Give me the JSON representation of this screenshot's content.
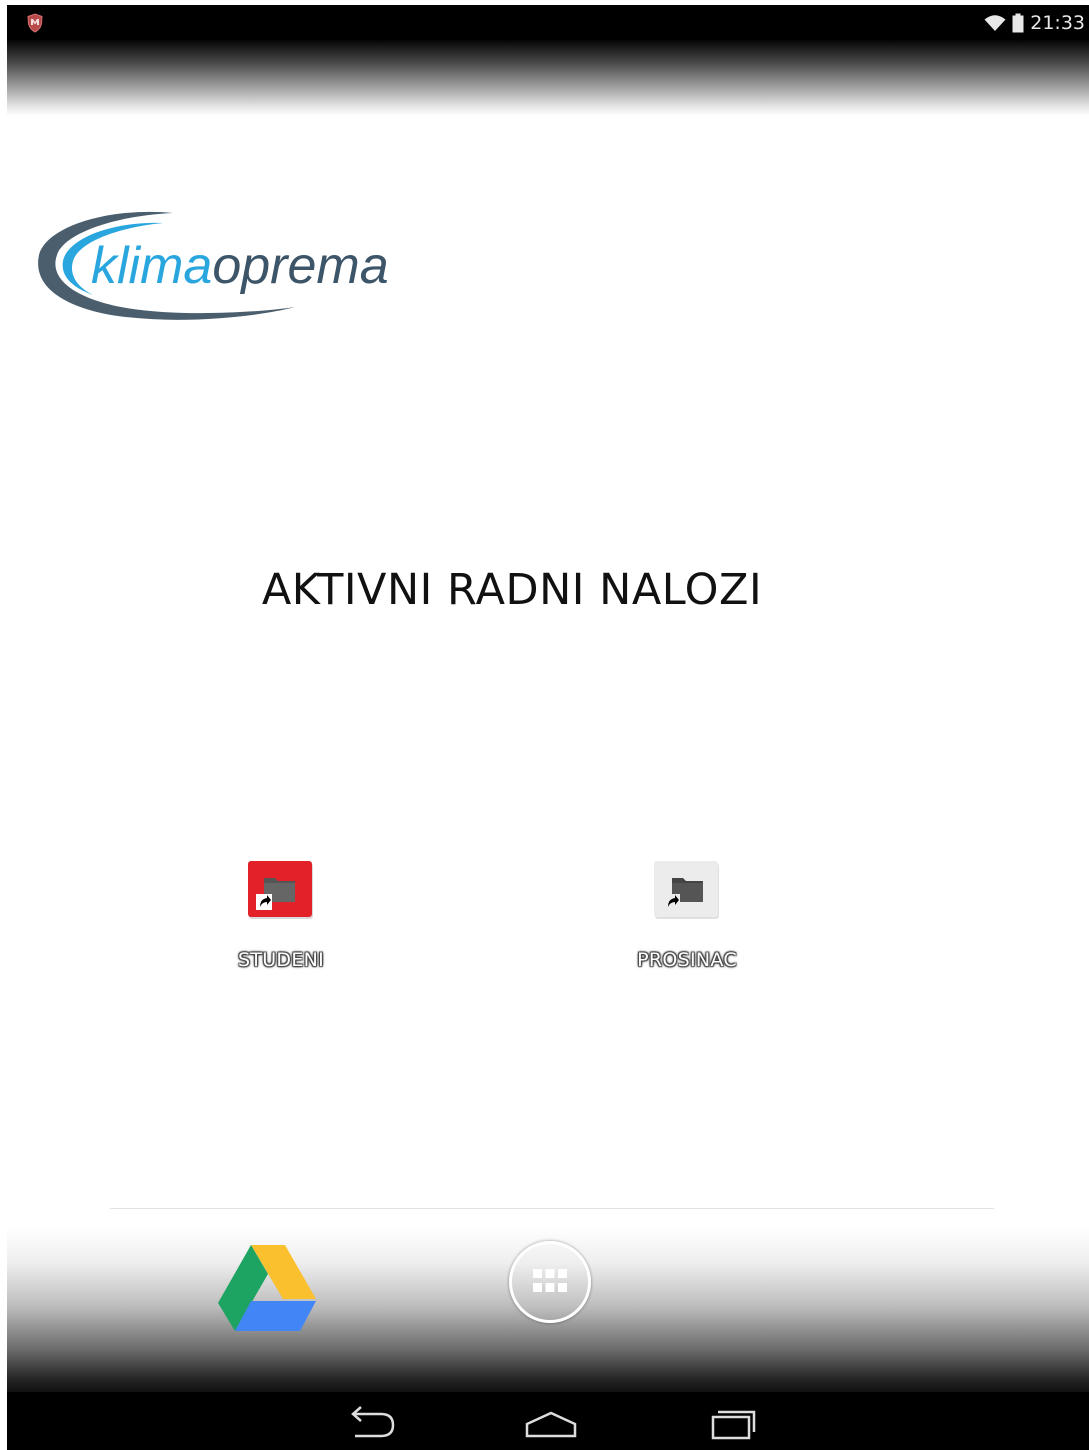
{
  "status_bar": {
    "time": "21:33",
    "left_icon": "shield-notification-icon",
    "wifi_icon": "wifi-icon",
    "battery_icon": "battery-icon"
  },
  "logo": {
    "text_part1": "klima",
    "text_part2": "oprema",
    "colors": {
      "blue": "#2aa6df",
      "dark": "#3d5569"
    }
  },
  "page_title": "AKTIVNI RADNI NALOZI",
  "shortcuts": [
    {
      "label": "STUDENI",
      "icon": "folder-shortcut-icon",
      "tile_color": "#e22228"
    },
    {
      "label": "PROSINAC",
      "icon": "folder-shortcut-icon",
      "tile_color": "#ececec"
    }
  ],
  "dock": {
    "app_icon": "google-drive-icon",
    "apps_button_icon": "app-drawer-icon"
  },
  "nav_bar": {
    "back_icon": "back-icon",
    "home_icon": "home-icon",
    "recents_icon": "recents-icon"
  }
}
